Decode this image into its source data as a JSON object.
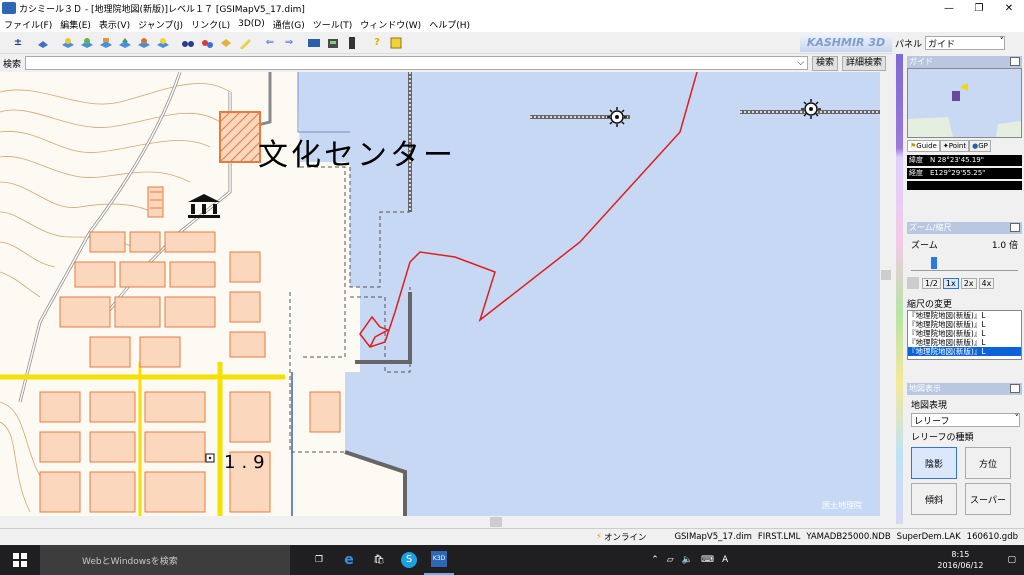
{
  "window": {
    "title": "カシミール３Ｄ - [地理院地図(新版)]レベル１７ [GSIMapV5_17.dim]"
  },
  "menu": [
    "ファイル(F)",
    "編集(E)",
    "表示(V)",
    "ジャンプ(J)",
    "リンク(L)",
    "3D(D)",
    "通信(G)",
    "ツール(T)",
    "ウィンドウ(W)",
    "ヘルプ(H)"
  ],
  "toolbar": {
    "brand": "KASHMIR 3D"
  },
  "search": {
    "label": "検索",
    "value": "",
    "button": "検索",
    "detail_button": "詳細検索"
  },
  "map": {
    "title_text": "文化センター",
    "elevation_label": "1.9",
    "copyright": "国土地理院"
  },
  "panel": {
    "label": "パネル",
    "selected": "ガイド",
    "guide_title": "ガイド",
    "tabs": [
      "Guide",
      "Point",
      "GP"
    ],
    "lat": "緯度　N 28°23'45.19\"",
    "lon": "経度　E129°29'55.25\"",
    "zoom_title": "ズーム/縮尺",
    "zoom_label": "ズーム",
    "zoom_value": "1.0 倍",
    "zoom_buttons": [
      "1/2",
      "1x",
      "2x",
      "4x"
    ],
    "scale_change": "縮尺の変更",
    "scale_items": [
      "『地理院地図(新版)』L",
      "『地理院地図(新版)』L",
      "『地理院地図(新版)』L",
      "『地理院地図(新版)』L",
      "『地理院地図(新版)』L"
    ],
    "mapdisp_title": "地図表示",
    "expression_label": "地図表現",
    "expression_value": "レリーフ",
    "relief_type": "レリーフの種類",
    "relief_buttons": [
      "陰影",
      "方位",
      "傾斜",
      "スーパー"
    ]
  },
  "status": [
    "オンライン",
    "GSIMapV5_17.dim",
    "FIRST.LML",
    "YAMADB25000.NDB",
    "SuperDem.LAK",
    "160610.gdb"
  ],
  "taskbar": {
    "search": "WebとWindowsを検索",
    "ime": "A",
    "time": "8:15",
    "date": "2016/06/12"
  }
}
